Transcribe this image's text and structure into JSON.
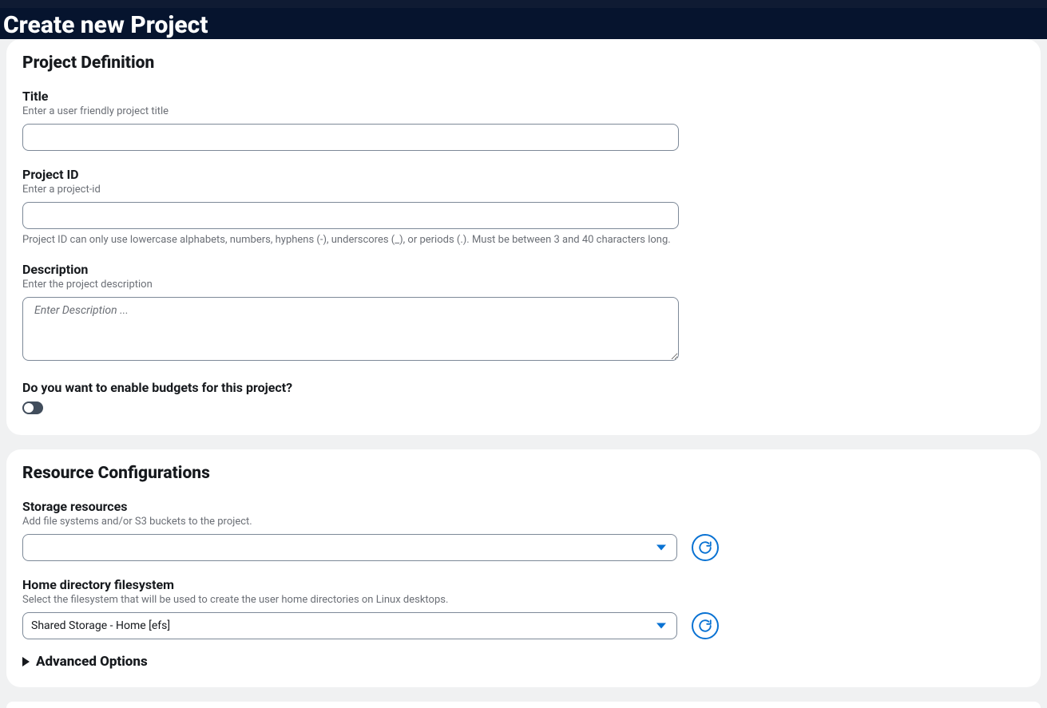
{
  "page": {
    "title": "Create new Project"
  },
  "definition": {
    "section_title": "Project Definition",
    "title": {
      "label": "Title",
      "hint": "Enter a user friendly project title",
      "value": ""
    },
    "project_id": {
      "label": "Project ID",
      "hint": "Enter a project-id",
      "value": "",
      "help": "Project ID can only use lowercase alphabets, numbers, hyphens (-), underscores (_), or periods (.). Must be between 3 and 40 characters long."
    },
    "description": {
      "label": "Description",
      "hint": "Enter the project description",
      "placeholder": "Enter Description ...",
      "value": ""
    },
    "budgets": {
      "question": "Do you want to enable budgets for this project?",
      "enabled": false
    }
  },
  "resources": {
    "section_title": "Resource Configurations",
    "storage": {
      "label": "Storage resources",
      "hint": "Add file systems and/or S3 buckets to the project.",
      "selected": ""
    },
    "home_fs": {
      "label": "Home directory filesystem",
      "hint": "Select the filesystem that will be used to create the user home directories on Linux desktops.",
      "selected": "Shared Storage - Home [efs]"
    },
    "advanced_label": "Advanced Options"
  }
}
